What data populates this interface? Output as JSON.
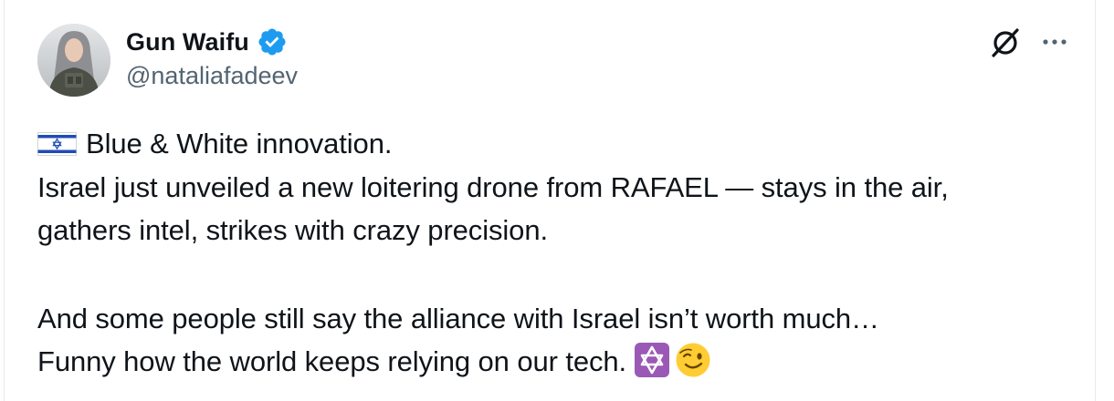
{
  "author": {
    "display_name": "Gun Waifu",
    "handle": "@nataliafadeev",
    "verified": true,
    "avatar_icon": "avatar-photo"
  },
  "header_actions": {
    "grok_icon": "grok-icon",
    "more_icon": "more-options-icon"
  },
  "tweet": {
    "line1_flag_icon": "israel-flag-emoji",
    "line1_text": "Blue & White innovation.",
    "line2_text": "Israel just unveiled a new loitering drone from RAFAEL — stays in the air,",
    "line3_text": "gathers intel, strikes with crazy precision.",
    "line4_text": "And some people still say the alliance with Israel isn’t worth much…",
    "line5_text": "Funny how the world keeps relying on our tech.",
    "line5_emojis": [
      "star-of-david-emoji",
      "winking-face-emoji"
    ]
  },
  "colors": {
    "text_primary": "#0f1419",
    "text_secondary": "#536471",
    "verified_blue": "#1d9bf0",
    "emoji_purple": "#9b59b6",
    "emoji_yellow": "#ffcc33"
  }
}
